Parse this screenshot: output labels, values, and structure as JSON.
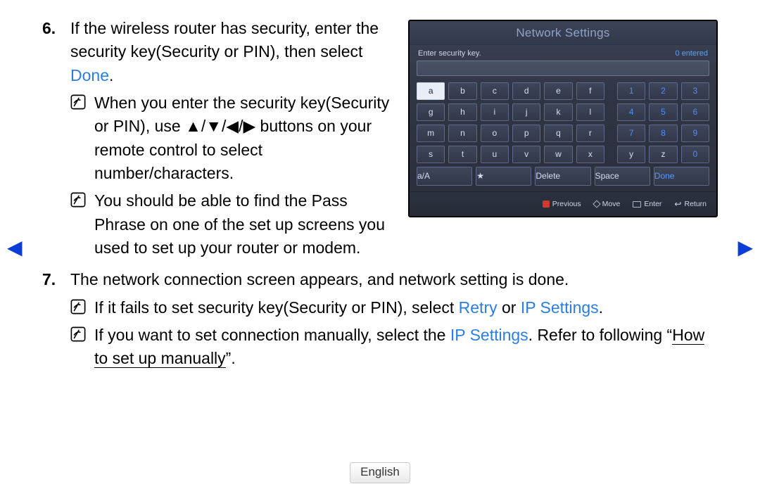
{
  "nav": {
    "prev_arrow": "◀",
    "next_arrow": "▶"
  },
  "footer": {
    "language": "English"
  },
  "steps": [
    {
      "num": "6.",
      "paragraphs": [
        {
          "segments": [
            {
              "t": "If the wireless router has security, enter the security key(Security or PIN), then select "
            },
            {
              "t": "Done",
              "cls": "blue"
            },
            {
              "t": "."
            }
          ]
        }
      ],
      "notes": [
        {
          "segments": [
            {
              "t": "When you enter the security key(Security or PIN), use ▲/▼/◀/▶ buttons on your remote control to select number/characters."
            }
          ]
        },
        {
          "segments": [
            {
              "t": "You should be able to find the Pass Phrase on one of the set up screens you used to set up your router or modem."
            }
          ]
        }
      ]
    },
    {
      "num": "7.",
      "paragraphs": [
        {
          "segments": [
            {
              "t": "The network connection screen appears, and network setting is done."
            }
          ]
        }
      ],
      "notes": [
        {
          "segments": [
            {
              "t": "If it fails to set security key(Security or PIN), select "
            },
            {
              "t": "Retry",
              "cls": "blue"
            },
            {
              "t": " or "
            },
            {
              "t": "IP Settings",
              "cls": "blue"
            },
            {
              "t": "."
            }
          ]
        },
        {
          "segments": [
            {
              "t": "If you want to set connection manually, select the "
            },
            {
              "t": "IP Settings",
              "cls": "blue"
            },
            {
              "t": ". Refer to following “"
            },
            {
              "t": "How to set up manually",
              "cls": "underline"
            },
            {
              "t": "”."
            }
          ]
        }
      ]
    }
  ],
  "screenshot": {
    "title": "Network Settings",
    "prompt": "Enter security key.",
    "entered": "0 entered",
    "rows": [
      [
        "a",
        "b",
        "c",
        "d",
        "e",
        "f",
        "1",
        "2",
        "3"
      ],
      [
        "g",
        "h",
        "i",
        "j",
        "k",
        "l",
        "4",
        "5",
        "6"
      ],
      [
        "m",
        "n",
        "o",
        "p",
        "q",
        "r",
        "7",
        "8",
        "9"
      ],
      [
        "s",
        "t",
        "u",
        "v",
        "w",
        "x",
        "y",
        "z",
        "0"
      ]
    ],
    "highlighted_key": "a",
    "bottom_row": [
      "a/A",
      "★",
      "Delete",
      "Space",
      "Done"
    ],
    "footer_items": [
      {
        "icon": "red",
        "label": "Previous"
      },
      {
        "icon": "move",
        "label": "Move"
      },
      {
        "icon": "enter",
        "label": "Enter"
      },
      {
        "icon": "return",
        "label": "Return"
      }
    ]
  }
}
